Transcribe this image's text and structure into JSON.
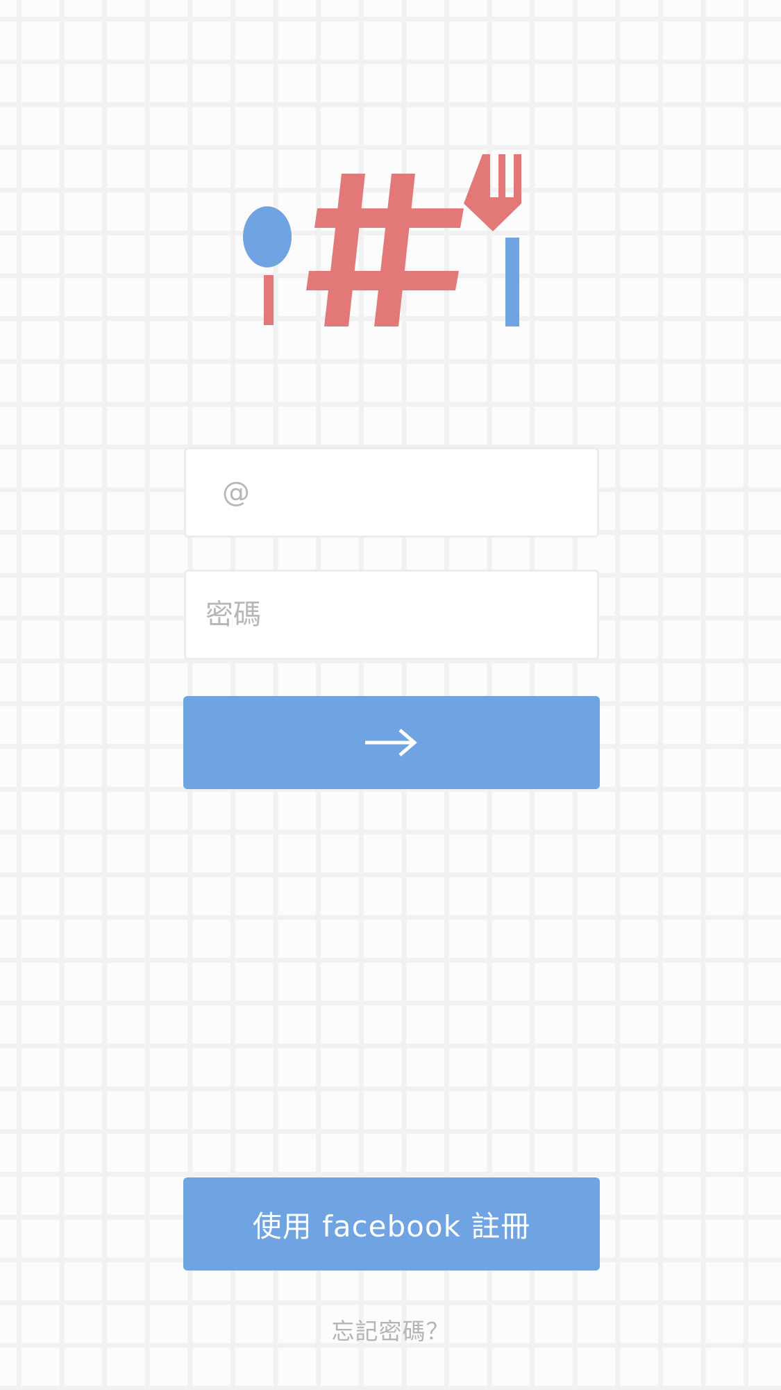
{
  "login": {
    "email_placeholder": "@",
    "email_value": "",
    "password_placeholder": "密碼",
    "password_value": "",
    "submit_icon": "arrow-right-icon"
  },
  "signup": {
    "facebook_label": "使用 facebook 註冊"
  },
  "forgot_password_label": "忘記密碼？",
  "logo": {
    "icons": [
      "spoon-icon",
      "hash-icon",
      "fork-icon"
    ]
  },
  "colors": {
    "accent_blue": "#6fa3e1",
    "logo_red": "#e27878",
    "background": "#fcfcfc",
    "grid": "#f1f1f1",
    "placeholder": "#b7b7b7"
  }
}
